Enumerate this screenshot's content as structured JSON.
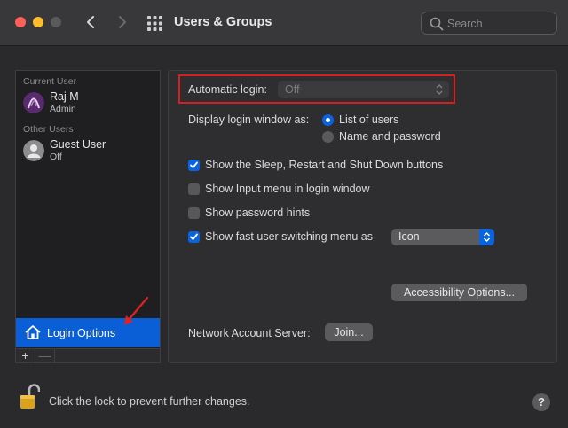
{
  "window": {
    "title": "Users & Groups"
  },
  "search": {
    "placeholder": "Search"
  },
  "sidebar": {
    "current_user_label": "Current User",
    "current_user": {
      "name": "Raj M",
      "role": "Admin"
    },
    "other_users_label": "Other Users",
    "other_users": [
      {
        "name": "Guest User",
        "role": "Off"
      }
    ],
    "login_options_label": "Login Options",
    "add_label": "+",
    "remove_label": "—"
  },
  "panel": {
    "automatic_login_label": "Automatic login:",
    "automatic_login_value": "Off",
    "display_login_label": "Display login window as:",
    "display_options": [
      {
        "label": "List of users",
        "selected": true
      },
      {
        "label": "Name and password",
        "selected": false
      }
    ],
    "checkboxes": [
      {
        "label": "Show the Sleep, Restart and Shut Down buttons",
        "checked": true
      },
      {
        "label": "Show Input menu in login window",
        "checked": false
      },
      {
        "label": "Show password hints",
        "checked": false
      },
      {
        "label": "Show fast user switching menu as",
        "checked": true
      }
    ],
    "fast_switch_value": "Icon",
    "accessibility_button": "Accessibility Options...",
    "network_server_label": "Network Account Server:",
    "join_button": "Join..."
  },
  "footer": {
    "lock_text": "Click the lock to prevent further changes.",
    "help_label": "?"
  },
  "colors": {
    "accent": "#0a64e0",
    "highlight_box": "#d62020",
    "window_bg": "#2a2a2c"
  }
}
